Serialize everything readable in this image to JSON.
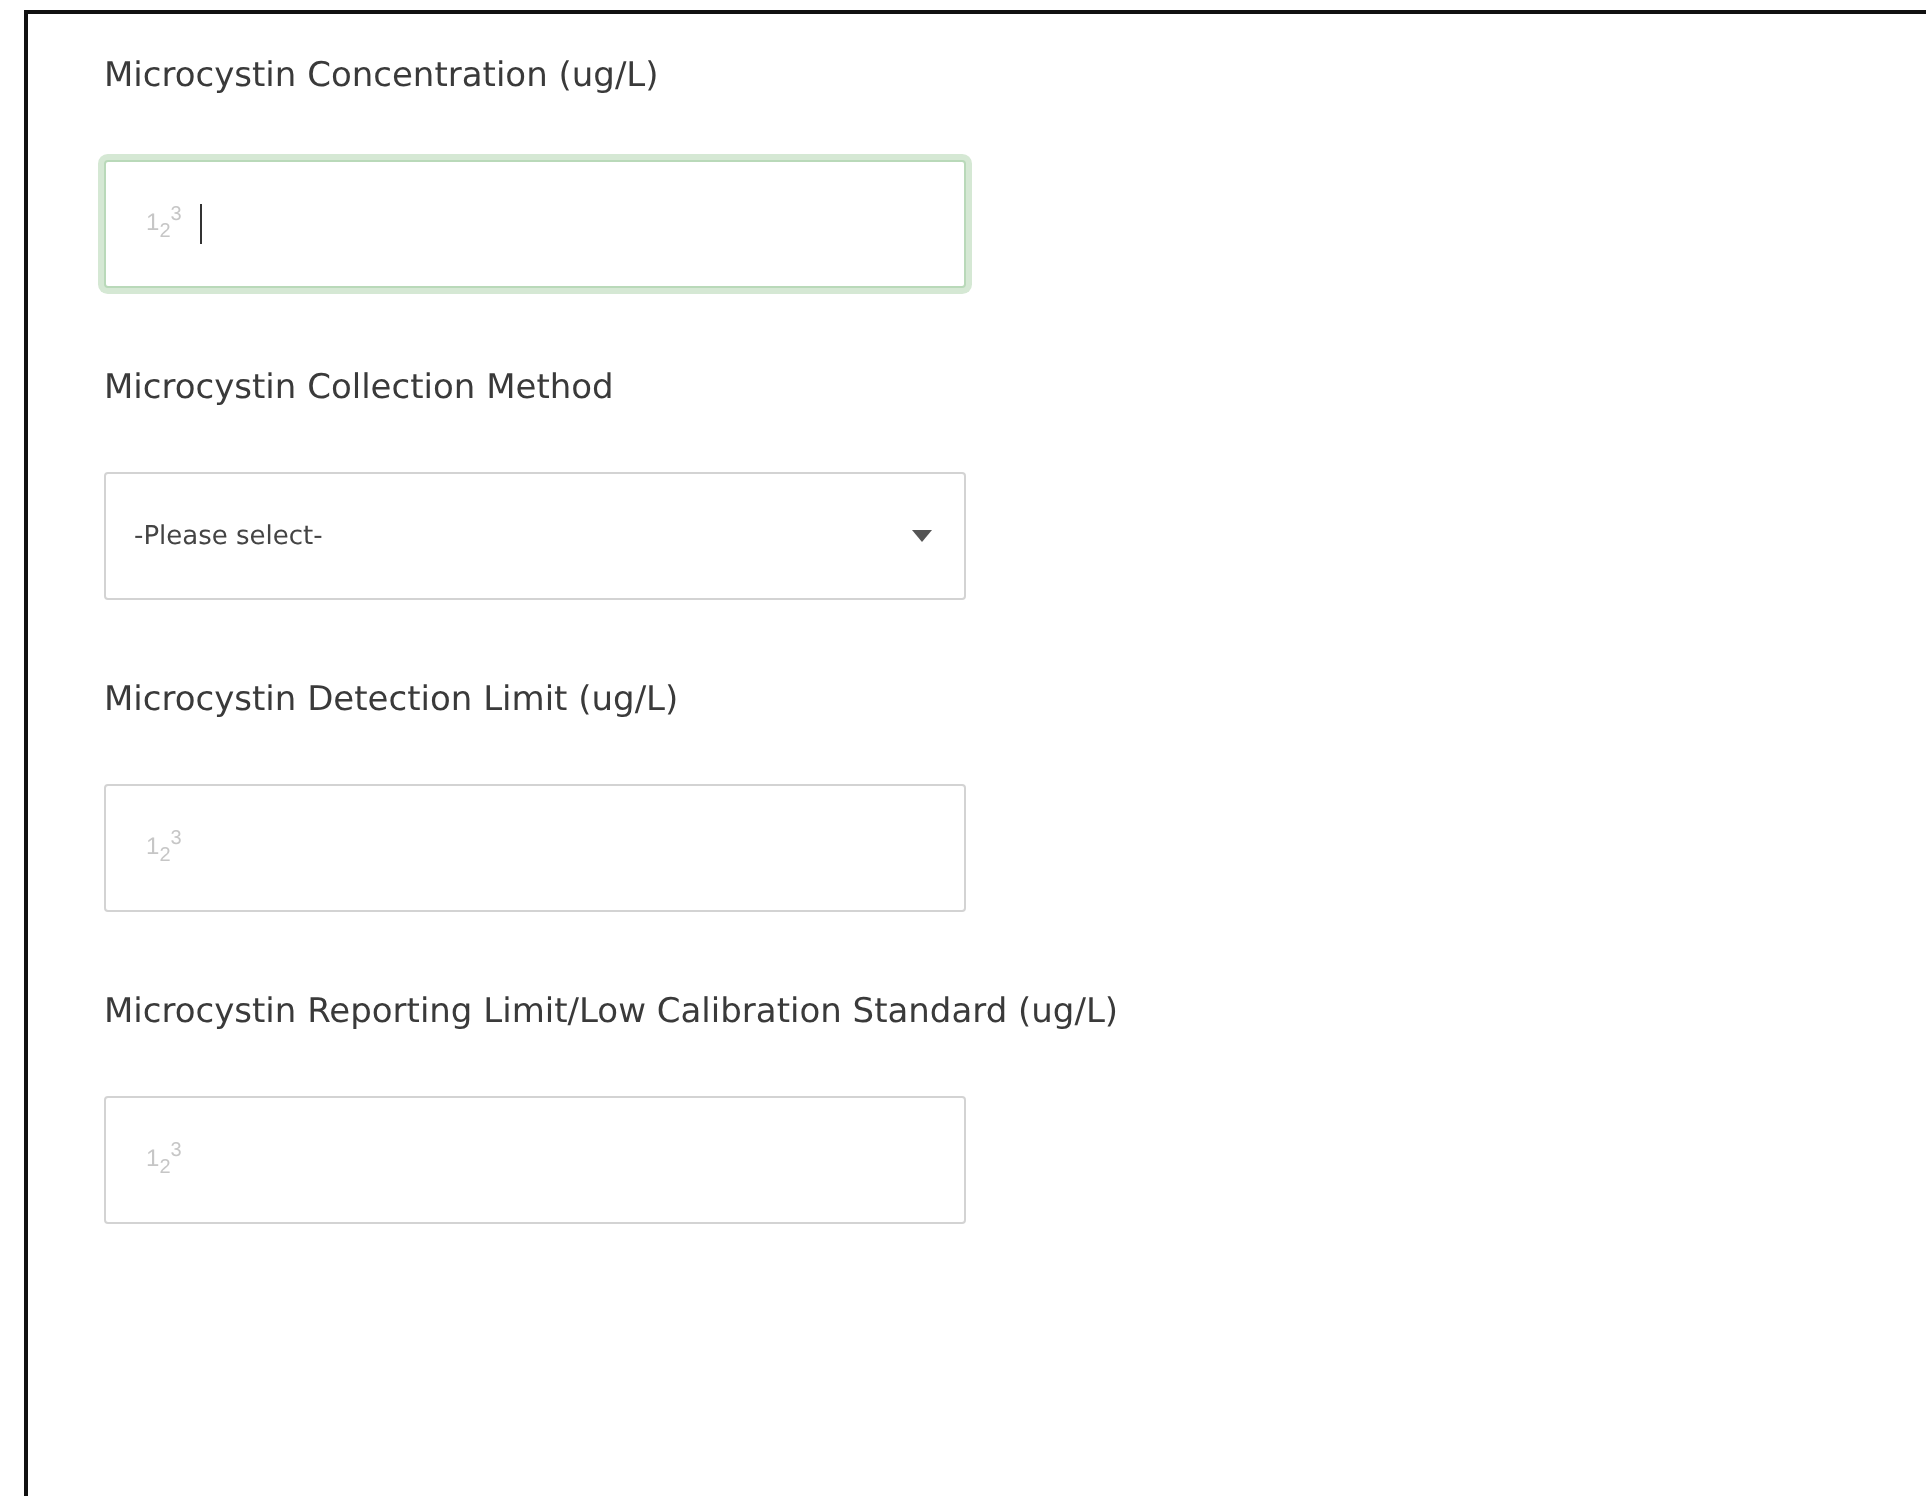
{
  "fields": [
    {
      "kind": "number",
      "label": "Microcystin Concentration (ug/L)",
      "hint": "1$_{2}$$^{3}$",
      "focused": true
    },
    {
      "kind": "select",
      "label": "Microcystin Collection Method",
      "value": "-Please select-",
      "focused": false
    },
    {
      "kind": "number",
      "label": "Microcystin Detection Limit (ug/L)",
      "hint": "1$_{2}$$^{3}$",
      "focused": false
    },
    {
      "kind": "number",
      "label": "Microcystin Reporting Limit/Low Calibration Standard (ug/L)",
      "hint": "1$_{2}$$^{3}$",
      "focused": false
    }
  ]
}
